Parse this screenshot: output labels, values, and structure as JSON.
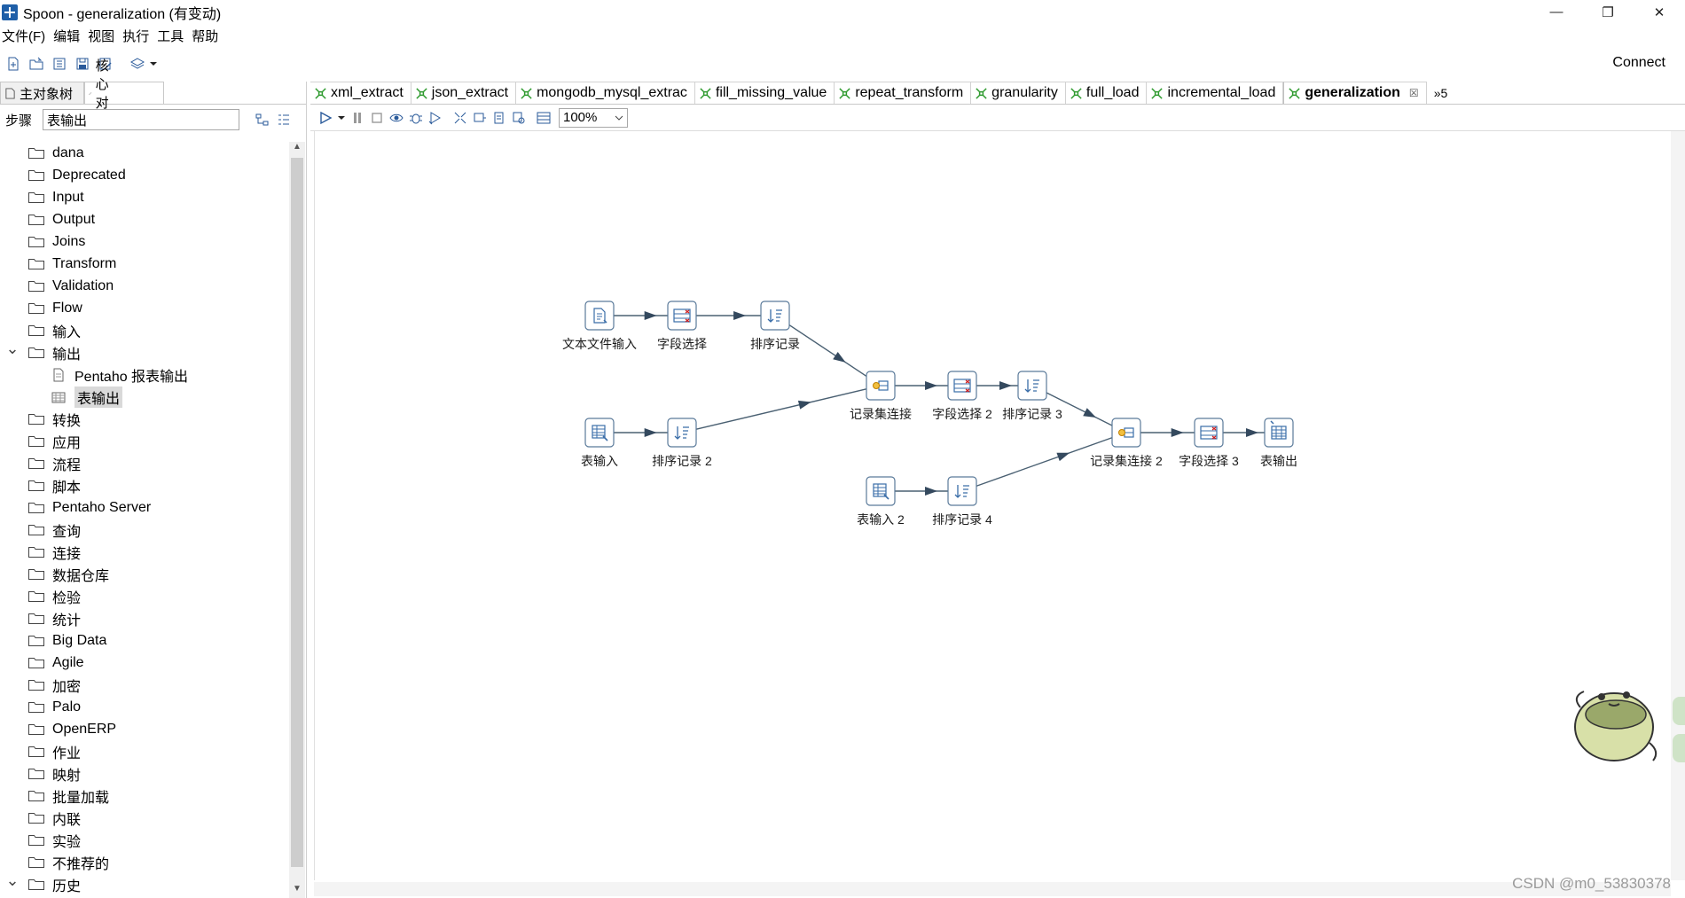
{
  "window": {
    "title": "Spoon - generalization (有变动)",
    "controls": [
      "—",
      "❐",
      "✕"
    ]
  },
  "menu": [
    "文件(F)",
    "编辑",
    "视图",
    "执行",
    "工具",
    "帮助"
  ],
  "toolbar": {
    "connect_label": "Connect"
  },
  "left_panel": {
    "tabs": [
      "主对象树",
      "核心对象"
    ],
    "steps_label": "步骤",
    "search_value": "表输出",
    "tree": [
      {
        "label": "dana",
        "kind": "folder"
      },
      {
        "label": "Deprecated",
        "kind": "folder"
      },
      {
        "label": "Input",
        "kind": "folder"
      },
      {
        "label": "Output",
        "kind": "folder"
      },
      {
        "label": "Joins",
        "kind": "folder"
      },
      {
        "label": "Transform",
        "kind": "folder"
      },
      {
        "label": "Validation",
        "kind": "folder"
      },
      {
        "label": "Flow",
        "kind": "folder"
      },
      {
        "label": "输入",
        "kind": "folder"
      },
      {
        "label": "输出",
        "kind": "folder",
        "expanded": true
      },
      {
        "label": "Pentaho 报表输出",
        "kind": "child"
      },
      {
        "label": "表输出",
        "kind": "child",
        "selected": true
      },
      {
        "label": "转换",
        "kind": "folder"
      },
      {
        "label": "应用",
        "kind": "folder"
      },
      {
        "label": "流程",
        "kind": "folder"
      },
      {
        "label": "脚本",
        "kind": "folder"
      },
      {
        "label": "Pentaho Server",
        "kind": "folder"
      },
      {
        "label": "查询",
        "kind": "folder"
      },
      {
        "label": "连接",
        "kind": "folder"
      },
      {
        "label": "数据仓库",
        "kind": "folder"
      },
      {
        "label": "检验",
        "kind": "folder"
      },
      {
        "label": "统计",
        "kind": "folder"
      },
      {
        "label": "Big Data",
        "kind": "folder"
      },
      {
        "label": "Agile",
        "kind": "folder"
      },
      {
        "label": "加密",
        "kind": "folder"
      },
      {
        "label": "Palo",
        "kind": "folder"
      },
      {
        "label": "OpenERP",
        "kind": "folder"
      },
      {
        "label": "作业",
        "kind": "folder"
      },
      {
        "label": "映射",
        "kind": "folder"
      },
      {
        "label": "批量加载",
        "kind": "folder"
      },
      {
        "label": "内联",
        "kind": "folder"
      },
      {
        "label": "实验",
        "kind": "folder"
      },
      {
        "label": "不推荐的",
        "kind": "folder"
      },
      {
        "label": "历史",
        "kind": "folder",
        "expanded": true
      }
    ]
  },
  "tabs": [
    {
      "label": "xml_extract"
    },
    {
      "label": "json_extract"
    },
    {
      "label": "mongodb_mysql_extrac"
    },
    {
      "label": "fill_missing_value"
    },
    {
      "label": "repeat_transform"
    },
    {
      "label": "granularity"
    },
    {
      "label": "full_load"
    },
    {
      "label": "incremental_load"
    },
    {
      "label": "generalization",
      "active": true
    }
  ],
  "tab_overflow": "»5",
  "zoom": "100%",
  "flow": {
    "steps": [
      {
        "id": "s1",
        "label": "文本文件输入",
        "icon": "text-file-input"
      },
      {
        "id": "s2",
        "label": "字段选择",
        "icon": "select-values"
      },
      {
        "id": "s3",
        "label": "排序记录",
        "icon": "sort-rows"
      },
      {
        "id": "s4",
        "label": "表输入",
        "icon": "table-input"
      },
      {
        "id": "s5",
        "label": "排序记录 2",
        "icon": "sort-rows"
      },
      {
        "id": "s6",
        "label": "记录集连接",
        "icon": "merge-join"
      },
      {
        "id": "s7",
        "label": "字段选择 2",
        "icon": "select-values"
      },
      {
        "id": "s8",
        "label": "排序记录 3",
        "icon": "sort-rows"
      },
      {
        "id": "s9",
        "label": "表输入 2",
        "icon": "table-input"
      },
      {
        "id": "s10",
        "label": "排序记录 4",
        "icon": "sort-rows"
      },
      {
        "id": "s11",
        "label": "记录集连接 2",
        "icon": "merge-join"
      },
      {
        "id": "s12",
        "label": "字段选择 3",
        "icon": "select-values"
      },
      {
        "id": "s13",
        "label": "表输出",
        "icon": "table-output"
      }
    ],
    "hops": [
      [
        "s1",
        "s2"
      ],
      [
        "s2",
        "s3"
      ],
      [
        "s3",
        "s6"
      ],
      [
        "s4",
        "s5"
      ],
      [
        "s5",
        "s6"
      ],
      [
        "s6",
        "s7"
      ],
      [
        "s7",
        "s8"
      ],
      [
        "s8",
        "s11"
      ],
      [
        "s9",
        "s10"
      ],
      [
        "s10",
        "s11"
      ],
      [
        "s11",
        "s12"
      ],
      [
        "s12",
        "s13"
      ]
    ]
  },
  "watermark": "CSDN @m0_53830378"
}
